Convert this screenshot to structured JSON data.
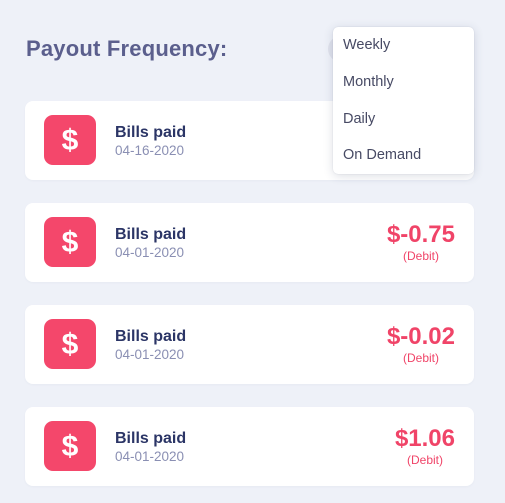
{
  "header": {
    "title": "Payout Frequency:"
  },
  "dropdown": {
    "options": [
      "Weekly",
      "Monthly",
      "Daily",
      "On Demand"
    ]
  },
  "transactions": [
    {
      "icon": "dollar-icon",
      "title": "Bills paid",
      "date": "04-16-2020",
      "amount": "",
      "type": ""
    },
    {
      "icon": "dollar-icon",
      "title": "Bills paid",
      "date": "04-01-2020",
      "amount": "$-0.75",
      "type": "(Debit)"
    },
    {
      "icon": "dollar-icon",
      "title": "Bills paid",
      "date": "04-01-2020",
      "amount": "$-0.02",
      "type": "(Debit)"
    },
    {
      "icon": "dollar-icon",
      "title": "Bills paid",
      "date": "04-01-2020",
      "amount": "$1.06",
      "type": "(Debit)"
    }
  ],
  "colors": {
    "background": "#eef1f8",
    "accent": "#f4476b",
    "amount": "#f04468",
    "title": "#2b3566",
    "heading": "#5b5f8d"
  }
}
